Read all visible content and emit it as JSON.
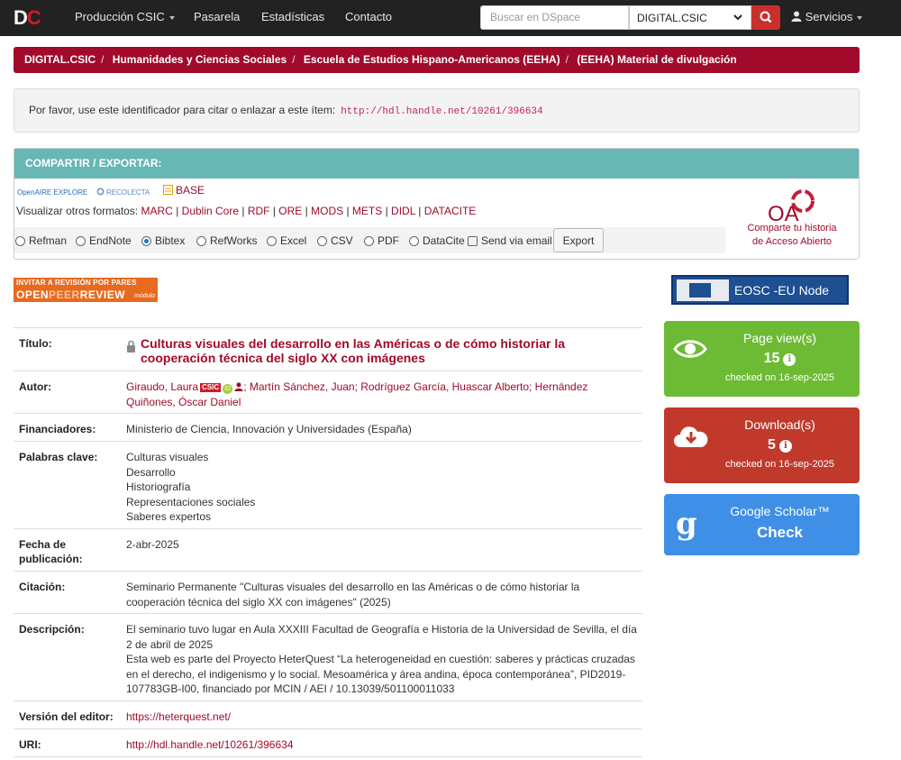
{
  "navbar": {
    "logo_d": "D",
    "logo_c": "C",
    "links": [
      "Producción CSIC",
      "Pasarela",
      "Estadísticas",
      "Contacto"
    ],
    "search_placeholder": "Buscar en DSpace",
    "scope": "DIGITAL.CSIC",
    "services": "Servicios"
  },
  "breadcrumb": [
    "DIGITAL.CSIC",
    "Humanidades y Ciencias Sociales",
    "Escuela de Estudios Hispano-Americanos (EEHA)",
    "(EEHA) Material de divulgación"
  ],
  "cite": {
    "text": "Por favor, use este identificador para citar o enlazar a este ítem:",
    "handle": "http://hdl.handle.net/10261/396634"
  },
  "share": {
    "header": "COMPARTIR / EXPORTAR:",
    "openaire": "OpenAIRE EXPLORE",
    "recolecta": "RECOLECTA",
    "base": "BASE",
    "formats_label": "Visualizar otros formatos:",
    "formats": [
      "MARC",
      "Dublin Core",
      "RDF",
      "ORE",
      "MODS",
      "METS",
      "DIDL",
      "DATACITE"
    ],
    "export_options": [
      "Refman",
      "EndNote",
      "Bibtex",
      "RefWorks",
      "Excel",
      "CSV",
      "PDF",
      "DataCite"
    ],
    "selected_option": "Bibtex",
    "send_mail": "Send via email",
    "export_button": "Export",
    "oa_text_1": "Comparte tu historia",
    "oa_text_2": "de Acceso Abierto"
  },
  "peer_review": {
    "line1": "INVITAR A REVISIÓN POR PARES",
    "open": "OPEN",
    "peer": "PEER",
    "review": "REVIEW",
    "modulo": "módulo"
  },
  "metadata": {
    "titulo_label": "Título:",
    "titulo": "Culturas visuales del desarrollo en las Américas o de cómo historiar la cooperación técnica del siglo XX con imágenes",
    "autor_label": "Autor:",
    "autor_1": "Giraudo, Laura",
    "autor_csic": "CSIC",
    "autor_orcid": "iD",
    "autor_rest": "; Martín Sánchez, Juan; Rodríguez García, Huascar Alberto; Hernández Quiñones, Óscar Daniel",
    "financiadores_label": "Financiadores:",
    "financiadores": "Ministerio de Ciencia, Innovación y Universidades (España)",
    "palabras_label": "Palabras clave:",
    "palabras": [
      "Culturas visuales",
      "Desarrollo",
      "Historiografía",
      "Representaciones sociales",
      "Saberes expertos"
    ],
    "fecha_label_1": "Fecha de",
    "fecha_label_2": "publicación:",
    "fecha": "2-abr-2025",
    "citacion_label": "Citación:",
    "citacion": "Seminario Permanente \"Culturas visuales del desarrollo en las Américas o de cómo historiar la cooperación técnica del siglo XX con imágenes\" (2025)",
    "descripcion_label": "Descripción:",
    "descripcion_1": "El seminario tuvo lugar en Aula XXXIII Facultad de Geografía e Historia de la Universidad de Sevilla, el día 2 de abril de 2025",
    "descripcion_2": "Esta web es parte del Proyecto HeterQuest “La heterogeneidad en cuestión: saberes y prácticas cruzadas en el derecho, el indigenismo y lo social. Mesoamérica y área andina, época contemporánea”, PID2019-107783GB-I00, financiado por MCIN / AEI / 10.13039/501100011033",
    "version_label": "Versión del editor:",
    "version": "https://heterquest.net/",
    "uri_label": "URI:",
    "uri": "http://hdl.handle.net/10261/396634"
  },
  "sidebar": {
    "eosc": "EOSC -EU Node",
    "pageviews_label": "Page view(s)",
    "pageviews": "15",
    "pageviews_checked": "checked on 16-sep-2025",
    "downloads_label": "Download(s)",
    "downloads": "5",
    "downloads_checked": "checked on 16-sep-2025",
    "scholar_label": "Google Scholar™",
    "scholar_check": "Check"
  },
  "colors": {
    "brand": "#a10a2b",
    "navbar": "#222222",
    "share_header": "#67b7b4",
    "pageviews": "#6dbb35",
    "downloads": "#c0392b",
    "scholar": "#3f8fe6"
  }
}
